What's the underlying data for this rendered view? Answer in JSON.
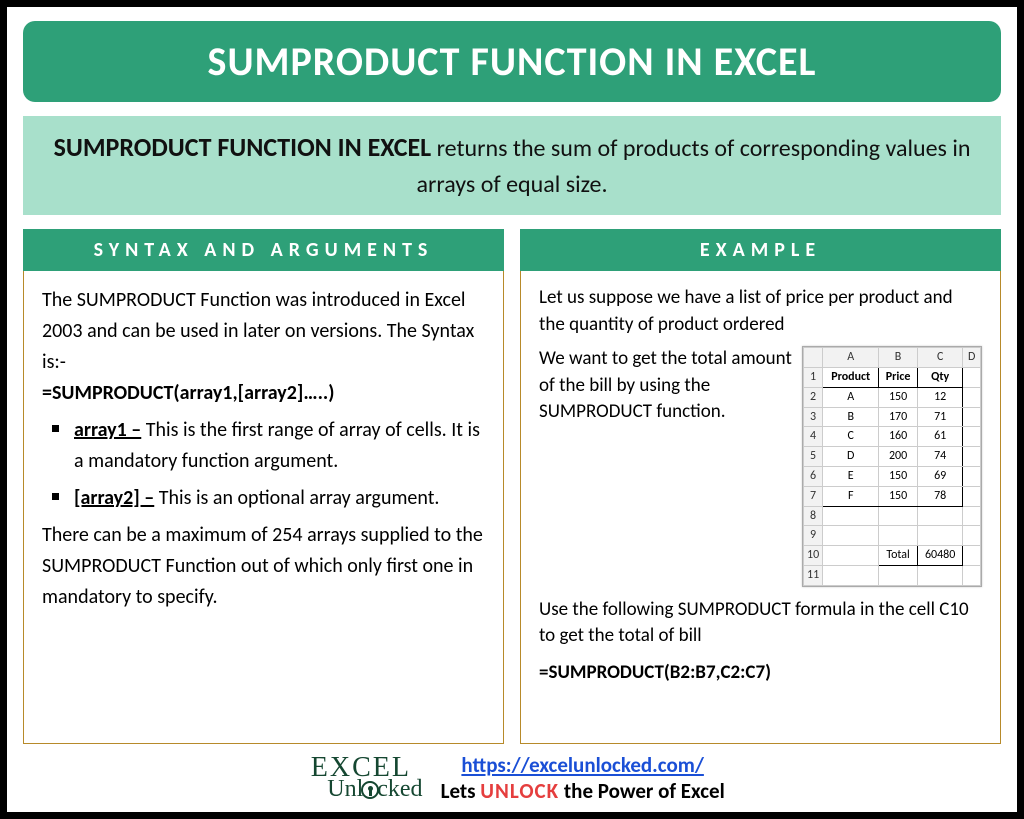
{
  "title": "SUMPRODUCT FUNCTION IN EXCEL",
  "description": {
    "strong": "SUMPRODUCT FUNCTION IN EXCEL",
    "rest": " returns the sum of products of corresponding values in arrays of equal size."
  },
  "syntax": {
    "header": "SYNTAX AND ARGUMENTS",
    "intro": "The SUMPRODUCT Function was introduced in Excel 2003 and can be used in later on versions. The Syntax is:-",
    "formula": "=SUMPRODUCT(array1,[array2]…..)",
    "args": [
      {
        "name": "array1 –",
        "desc": " This is the first range of array of cells. It is a mandatory function argument."
      },
      {
        "name": "[array2] –",
        "desc": " This is an optional array argument."
      }
    ],
    "note": "There can be a maximum of 254 arrays supplied to the SUMPRODUCT Function out of which only first one in mandatory to specify."
  },
  "example": {
    "header": "EXAMPLE",
    "intro": "Let us suppose we have a list of price per product and the quantity of product ordered",
    "goal": "We want to get the total amount of the bill by using the SUMPRODUCT function.",
    "instruction": "Use the following SUMPRODUCT formula in the cell C10 to get the total of bill",
    "formula": "=SUMPRODUCT(B2:B7,C2:C7)",
    "sheet": {
      "cols": [
        "A",
        "B",
        "C",
        "D"
      ],
      "headers": [
        "Product",
        "Price",
        "Qty"
      ],
      "rows": [
        [
          "A",
          "150",
          "12"
        ],
        [
          "B",
          "170",
          "71"
        ],
        [
          "C",
          "160",
          "61"
        ],
        [
          "D",
          "200",
          "74"
        ],
        [
          "E",
          "150",
          "69"
        ],
        [
          "F",
          "150",
          "78"
        ]
      ],
      "total_label": "Total",
      "total_value": "60480"
    }
  },
  "footer": {
    "logo_line1_a": "E",
    "logo_line1_b": "CEL",
    "logo_line2": "Unlocked",
    "url": "https://excelunlocked.com/",
    "tagline_a": "Lets ",
    "tagline_b": "UNLOCK",
    "tagline_c": " the Power of Excel"
  }
}
